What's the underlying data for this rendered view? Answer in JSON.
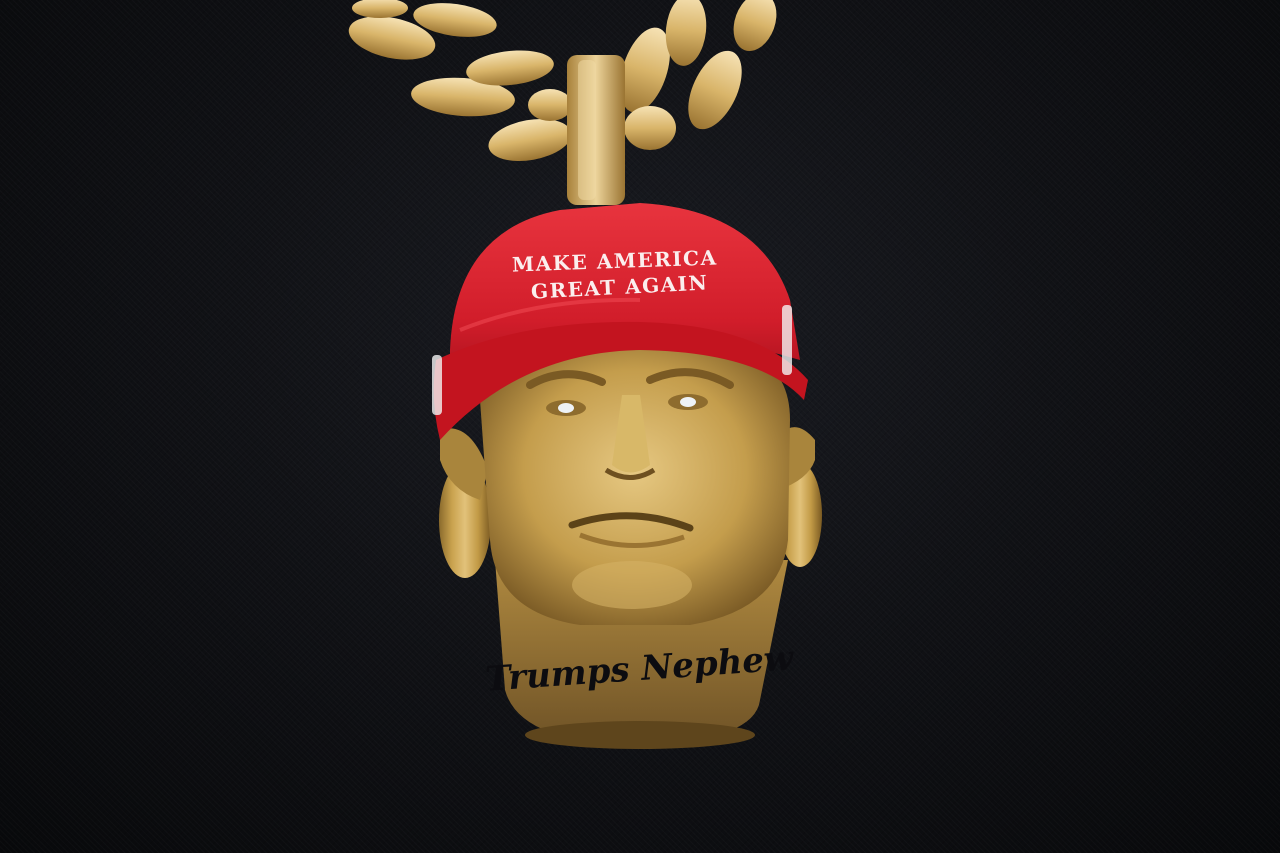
{
  "photo": {
    "subject": "gold-head-pendant-necklace",
    "cap": {
      "line1": "MAKE AMERICA",
      "line2": "GREAT AGAIN"
    },
    "engraving": "Trumps Nephew",
    "colors": {
      "background": "#0d0e12",
      "cap_red": "#d6202c",
      "gold": "#c9a24e",
      "chain_gold": "#d9b56a"
    }
  }
}
